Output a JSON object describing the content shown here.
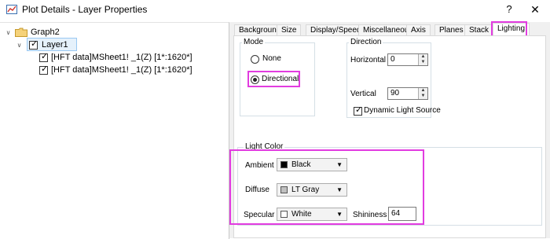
{
  "window": {
    "title": "Plot Details - Layer Properties",
    "help_label": "?",
    "close_label": "✕"
  },
  "tree": {
    "root_label": "Graph2",
    "layer_label": "Layer1",
    "items": [
      {
        "label": "[HFT data]MSheet1! _1(Z) [1*:1620*]"
      },
      {
        "label": "[HFT data]MSheet1! _1(Z) [1*:1620*]"
      }
    ]
  },
  "tabs": [
    {
      "label": "Background"
    },
    {
      "label": "Size"
    },
    {
      "label": "Display/Speed"
    },
    {
      "label": "Miscellaneous"
    },
    {
      "label": "Axis"
    },
    {
      "label": "Planes"
    },
    {
      "label": "Stack"
    },
    {
      "label": "Lighting"
    }
  ],
  "active_tab": "Lighting",
  "mode": {
    "title": "Mode",
    "option_none": "None",
    "option_directional": "Directional",
    "selected": "Directional"
  },
  "direction": {
    "title": "Direction",
    "horizontal_label": "Horizontal",
    "horizontal_value": "0",
    "vertical_label": "Vertical",
    "vertical_value": "90",
    "dynamic_label": "Dynamic Light Source",
    "dynamic_checked": true
  },
  "light_color": {
    "title": "Light Color",
    "ambient_label": "Ambient",
    "ambient_value": "Black",
    "ambient_color": "#000000",
    "diffuse_label": "Diffuse",
    "diffuse_value": "LT Gray",
    "diffuse_color": "#c0c0c0",
    "specular_label": "Specular",
    "specular_value": "White",
    "specular_color": "#ffffff",
    "shininess_label": "Shininess",
    "shininess_value": "64"
  },
  "highlight_color": "#e23ce0"
}
